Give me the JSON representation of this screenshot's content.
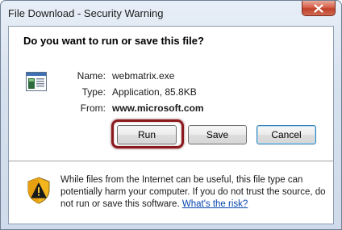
{
  "window": {
    "title": "File Download - Security Warning"
  },
  "dialog": {
    "question": "Do you want to run or save this file?",
    "labels": {
      "name": "Name:",
      "type": "Type:",
      "from": "From:"
    },
    "values": {
      "name": "webmatrix.exe",
      "type": "Application, 85.8KB",
      "from": "www.microsoft.com"
    },
    "buttons": {
      "run": "Run",
      "save": "Save",
      "cancel": "Cancel"
    },
    "warning_text": "While files from the Internet can be useful, this file type can potentially harm your computer. If you do not trust the source, do not run or save this software.",
    "warning_link": "What's the risk?"
  },
  "icons": {
    "close": "close-icon",
    "file": "application-file-icon",
    "warning": "security-shield-icon"
  },
  "colors": {
    "highlight_border": "#8b1a1e",
    "link": "#0645ad",
    "close_button": "#c0402a"
  }
}
